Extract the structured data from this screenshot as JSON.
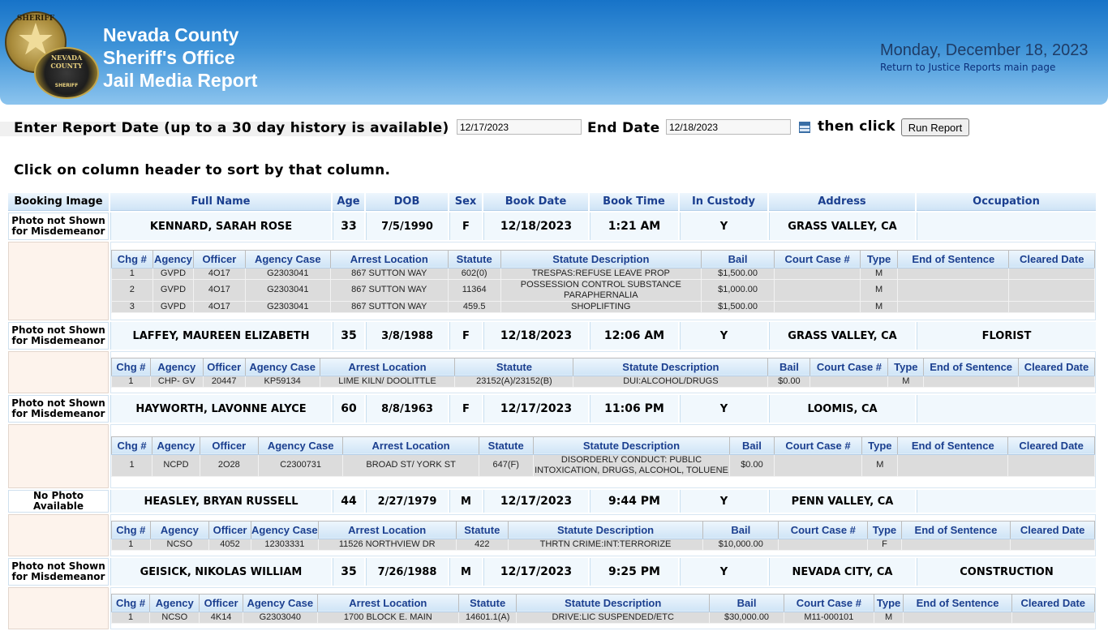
{
  "header": {
    "badge_top_text": "SHERIFF",
    "badge_bottom_text": "NEVADA COUNTY",
    "badge_bottom_sub": "SHERIFF",
    "title_line1": "Nevada County",
    "title_line2": "Sheriff's Office",
    "title_line3": "Jail Media Report",
    "date": "Monday, December 18, 2023",
    "return_link": "Return to Justice Reports main page"
  },
  "form": {
    "report_date_label": "Enter Report Date (up to a 30 day history is available)",
    "start_date_value": "12/17/2023",
    "end_date_label": "End Date",
    "end_date_value": "12/18/2023",
    "then_click_label": "then click",
    "run_button_label": "Run Report"
  },
  "sort_note": "Click on column header to sort by that column.",
  "columns": [
    "Booking Image",
    "Full Name",
    "Age",
    "DOB",
    "Sex",
    "Book Date",
    "Book Time",
    "In Custody",
    "Address",
    "Occupation"
  ],
  "charge_columns": [
    "Chg #",
    "Agency",
    "Officer",
    "Agency Case",
    "Arrest Location",
    "Statute",
    "Statute Description",
    "Bail",
    "Court Case #",
    "Type",
    "End of Sentence",
    "Cleared Date"
  ],
  "records": [
    {
      "image": "Photo not Shown for Misdemeanor",
      "name": "KENNARD, SARAH ROSE",
      "age": "33",
      "dob": "7/5/1990",
      "sex": "F",
      "book_date": "12/18/2023",
      "book_time": "1:21 AM",
      "custody": "Y",
      "address": "GRASS VALLEY, CA",
      "occupation": "",
      "charges": [
        {
          "chg": "1",
          "agency": "GVPD",
          "officer": "4O17",
          "case": "G2303041",
          "location": "867 SUTTON WAY",
          "statute": "602(0)",
          "desc": "TRESPAS:REFUSE LEAVE PROP",
          "bail": "$1,500.00",
          "court": "",
          "type": "M",
          "end": "",
          "cleared": ""
        },
        {
          "chg": "2",
          "agency": "GVPD",
          "officer": "4O17",
          "case": "G2303041",
          "location": "867 SUTTON WAY",
          "statute": "11364",
          "desc": "POSSESSION CONTROL SUBSTANCE PARAPHERNALIA",
          "bail": "$1,000.00",
          "court": "",
          "type": "M",
          "end": "",
          "cleared": ""
        },
        {
          "chg": "3",
          "agency": "GVPD",
          "officer": "4O17",
          "case": "G2303041",
          "location": "867 SUTTON WAY",
          "statute": "459.5",
          "desc": "SHOPLIFTING",
          "bail": "$1,500.00",
          "court": "",
          "type": "M",
          "end": "",
          "cleared": ""
        }
      ]
    },
    {
      "image": "Photo not Shown for Misdemeanor",
      "name": "LAFFEY, MAUREEN ELIZABETH",
      "age": "35",
      "dob": "3/8/1988",
      "sex": "F",
      "book_date": "12/18/2023",
      "book_time": "12:06 AM",
      "custody": "Y",
      "address": "GRASS VALLEY, CA",
      "occupation": "FLORIST",
      "charges": [
        {
          "chg": "1",
          "agency": "CHP- GV",
          "officer": "20447",
          "case": "KP59134",
          "location": "LIME KILN/ DOOLITTLE",
          "statute": "23152(A)/23152(B)",
          "desc": "DUI:ALCOHOL/DRUGS",
          "bail": "$0.00",
          "court": "",
          "type": "M",
          "end": "",
          "cleared": ""
        }
      ]
    },
    {
      "image": "Photo not Shown for Misdemeanor",
      "name": "HAYWORTH, LAVONNE ALYCE",
      "age": "60",
      "dob": "8/8/1963",
      "sex": "F",
      "book_date": "12/17/2023",
      "book_time": "11:06 PM",
      "custody": "Y",
      "address": "LOOMIS, CA",
      "occupation": "",
      "charges": [
        {
          "chg": "1",
          "agency": "NCPD",
          "officer": "2O28",
          "case": "C2300731",
          "location": "BROAD ST/ YORK ST",
          "statute": "647(F)",
          "desc": "DISORDERLY CONDUCT: PUBLIC INTOXICATION, DRUGS, ALCOHOL, TOLUENE",
          "bail": "$0.00",
          "court": "",
          "type": "M",
          "end": "",
          "cleared": ""
        }
      ]
    },
    {
      "image": "No Photo Available",
      "name": "HEASLEY, BRYAN RUSSELL",
      "age": "44",
      "dob": "2/27/1979",
      "sex": "M",
      "book_date": "12/17/2023",
      "book_time": "9:44 PM",
      "custody": "Y",
      "address": "PENN VALLEY, CA",
      "occupation": "",
      "charges": [
        {
          "chg": "1",
          "agency": "NCSO",
          "officer": "4052",
          "case": "12303331",
          "location": "11526 NORTHVIEW DR",
          "statute": "422",
          "desc": "THRTN CRIME:INT:TERRORIZE",
          "bail": "$10,000.00",
          "court": "",
          "type": "F",
          "end": "",
          "cleared": ""
        }
      ]
    },
    {
      "image": "Photo not Shown for Misdemeanor",
      "name": "GEISICK, NIKOLAS WILLIAM",
      "age": "35",
      "dob": "7/26/1988",
      "sex": "M",
      "book_date": "12/17/2023",
      "book_time": "9:25 PM",
      "custody": "Y",
      "address": "NEVADA CITY, CA",
      "occupation": "CONSTRUCTION",
      "charges": [
        {
          "chg": "1",
          "agency": "NCSO",
          "officer": "4K14",
          "case": "G2303040",
          "location": "1700 BLOCK E. MAIN",
          "statute": "14601.1(A)",
          "desc": "DRIVE:LIC SUSPENDED/ETC",
          "bail": "$30,000.00",
          "court": "M11-000101",
          "type": "M",
          "end": "",
          "cleared": ""
        }
      ]
    }
  ]
}
